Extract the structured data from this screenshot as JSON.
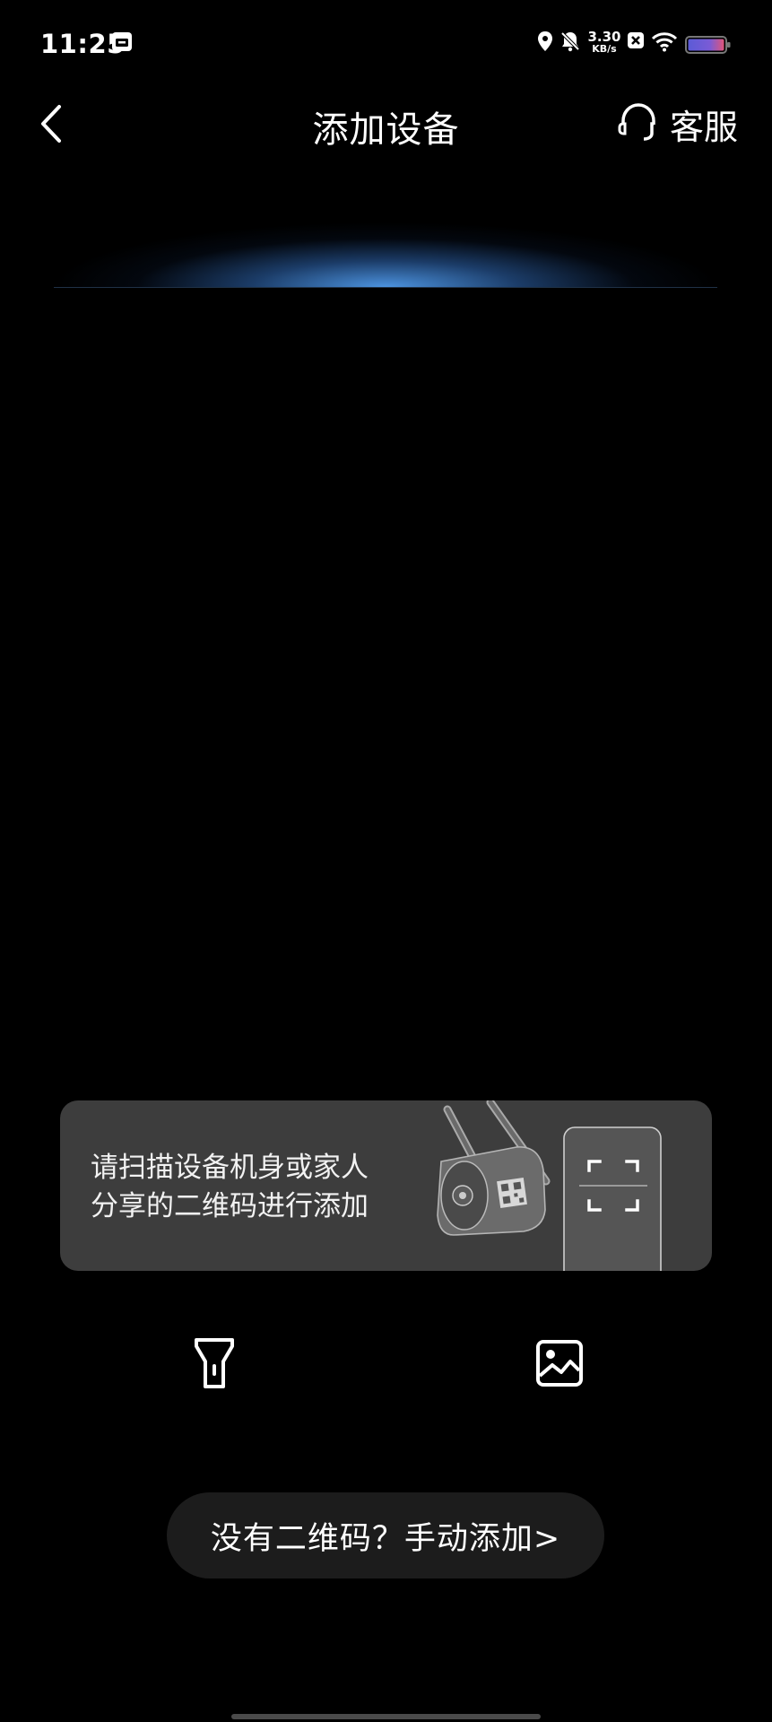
{
  "status_bar": {
    "time": "11:25",
    "net_speed_value": "3.30",
    "net_speed_unit": "KB/s",
    "icons": [
      "calendar-icon",
      "location-icon",
      "mute-bell-icon",
      "close-box-icon",
      "wifi-icon",
      "battery-icon"
    ]
  },
  "header": {
    "title": "添加设备",
    "service_label": "客服",
    "icons": [
      "back-arrow-icon",
      "headset-icon"
    ]
  },
  "hint": {
    "line1": "请扫描设备机身或家人",
    "line2": "分享的二维码进行添加"
  },
  "actions": {
    "icons": [
      "flashlight-icon",
      "image-album-icon"
    ],
    "manual_add_label": "没有二维码？手动添加>"
  },
  "colors": {
    "background": "#000000",
    "card": "#3d3d3d",
    "button": "#1c1c1c",
    "glow": "#5a9be6"
  }
}
